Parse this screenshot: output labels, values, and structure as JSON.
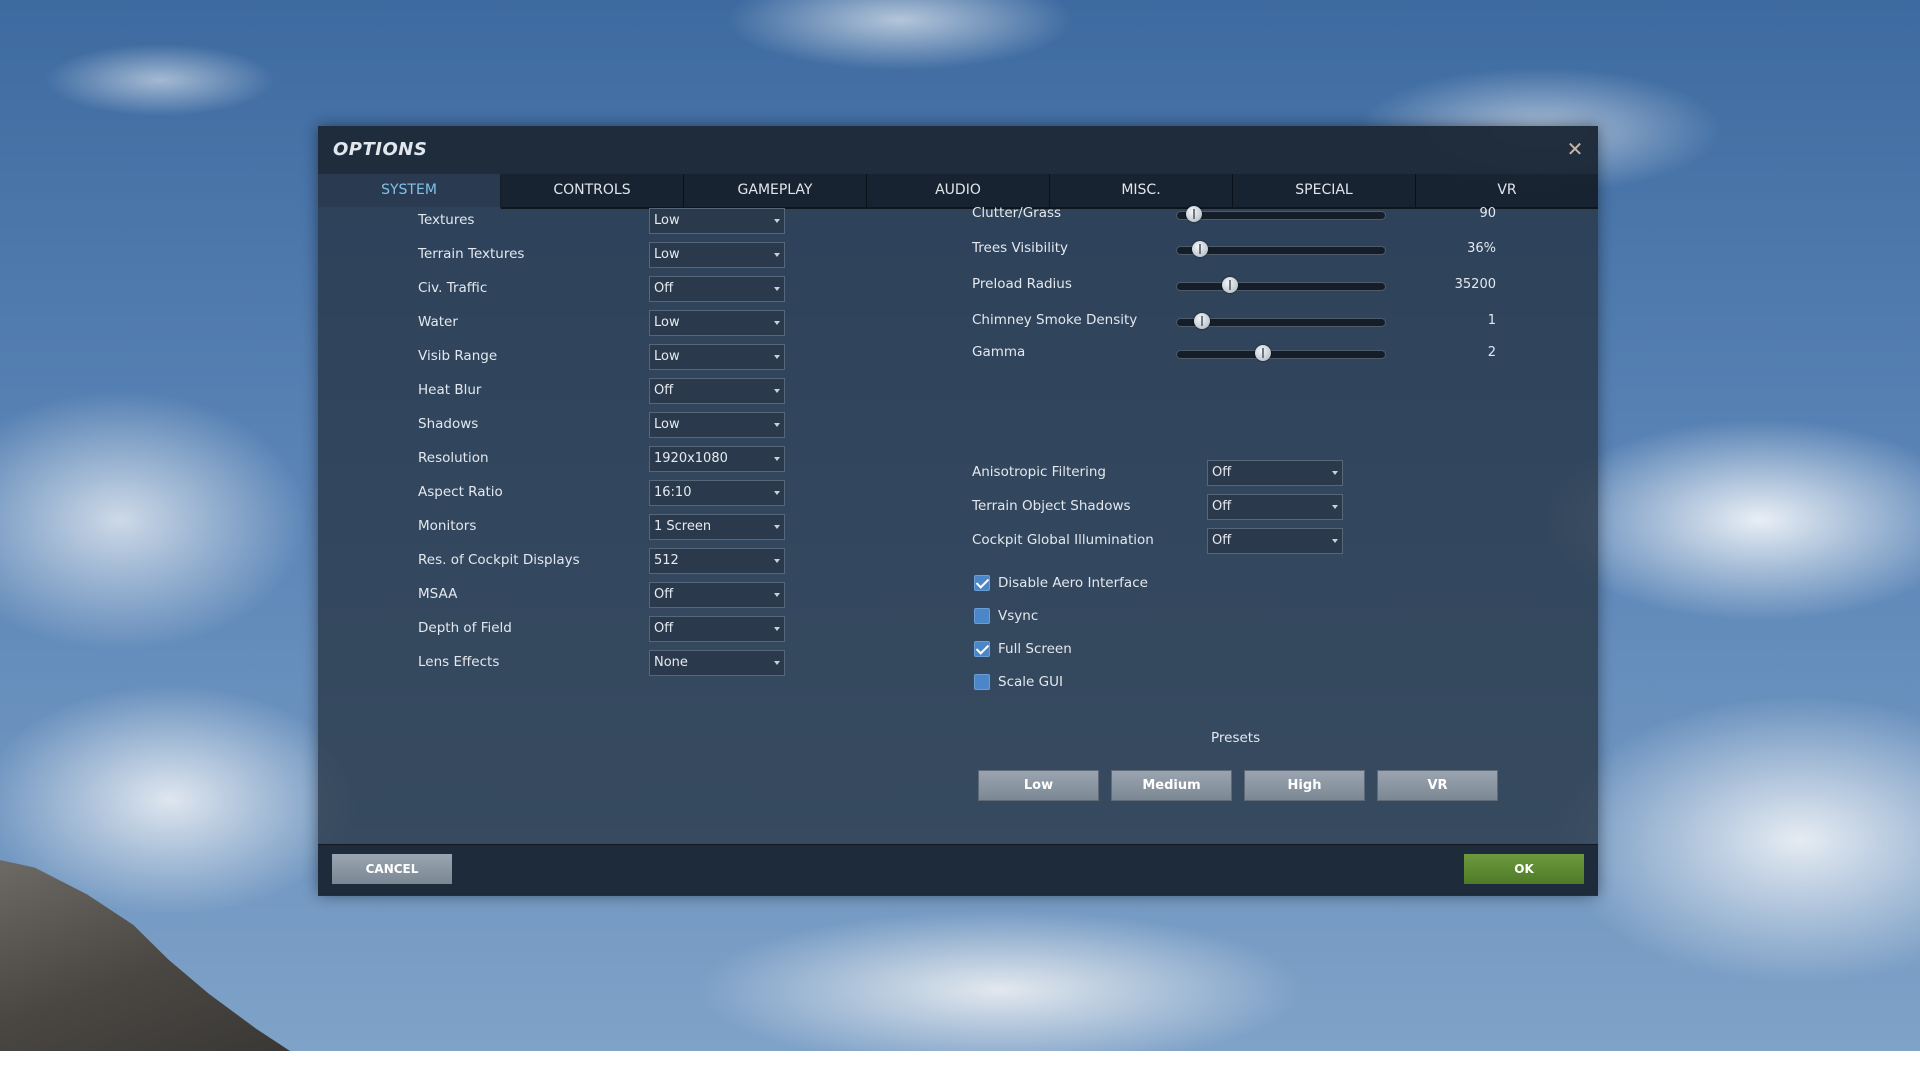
{
  "dialog": {
    "title": "OPTIONS",
    "close_icon": "close-icon"
  },
  "tabs": [
    {
      "label": "SYSTEM",
      "active": true
    },
    {
      "label": "CONTROLS"
    },
    {
      "label": "GAMEPLAY"
    },
    {
      "label": "AUDIO"
    },
    {
      "label": "MISC."
    },
    {
      "label": "SPECIAL"
    },
    {
      "label": "VR"
    }
  ],
  "left_settings": [
    {
      "label": "Textures",
      "value": "Low"
    },
    {
      "label": "Terrain Textures",
      "value": "Low"
    },
    {
      "label": "Civ. Traffic",
      "value": "Off"
    },
    {
      "label": "Water",
      "value": "Low"
    },
    {
      "label": "Visib Range",
      "value": "Low"
    },
    {
      "label": "Heat Blur",
      "value": "Off"
    },
    {
      "label": "Shadows",
      "value": "Low"
    },
    {
      "label": "Resolution",
      "value": "1920x1080"
    },
    {
      "label": "Aspect Ratio",
      "value": "16:10"
    },
    {
      "label": "Monitors",
      "value": "1 Screen"
    },
    {
      "label": "Res. of Cockpit Displays",
      "value": "512"
    },
    {
      "label": "MSAA",
      "value": "Off"
    },
    {
      "label": "Depth of Field",
      "value": "Off"
    },
    {
      "label": "Lens Effects",
      "value": "None"
    }
  ],
  "sliders": [
    {
      "label": "Clutter/Grass",
      "value": "90",
      "fraction": 0.08
    },
    {
      "label": "Trees Visibility",
      "value": "36%",
      "fraction": 0.11
    },
    {
      "label": "Preload Radius",
      "value": "35200",
      "fraction": 0.25
    },
    {
      "label": "Chimney Smoke Density",
      "value": "1",
      "fraction": 0.12
    },
    {
      "label": "Gamma",
      "value": "2",
      "fraction": 0.41
    }
  ],
  "right_selects": [
    {
      "label": "Anisotropic Filtering",
      "value": "Off"
    },
    {
      "label": "Terrain Object Shadows",
      "value": "Off"
    },
    {
      "label": "Cockpit Global Illumination",
      "value": "Off"
    }
  ],
  "checkboxes": [
    {
      "label": "Disable Aero Interface",
      "checked": true
    },
    {
      "label": "Vsync",
      "checked": false
    },
    {
      "label": "Full Screen",
      "checked": true
    },
    {
      "label": "Scale GUI",
      "checked": false
    }
  ],
  "presets": {
    "label": "Presets",
    "buttons": [
      "Low",
      "Medium",
      "High",
      "VR"
    ]
  },
  "footer": {
    "cancel_label": "CANCEL",
    "ok_label": "OK"
  },
  "colors": {
    "ok": "#5a8a32",
    "active_tab_text": "#7fc2ea",
    "checkbox": "#4a86c8"
  }
}
